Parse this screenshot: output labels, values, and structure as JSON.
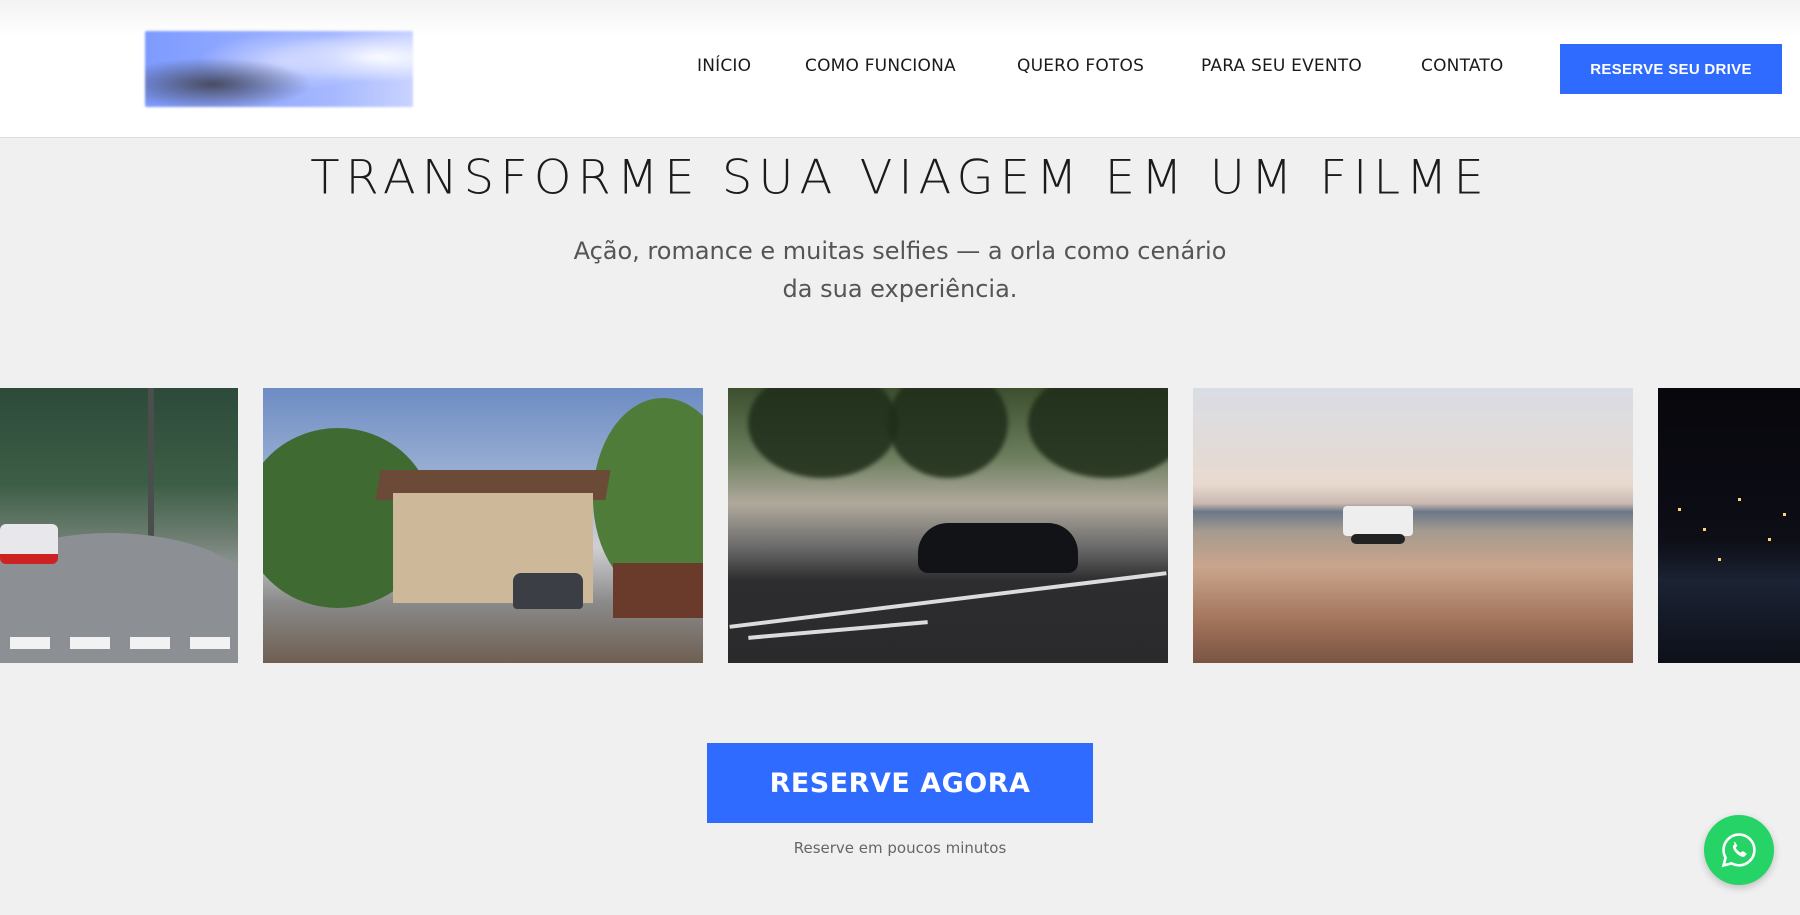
{
  "header": {
    "logo_alt": "Logo",
    "nav": [
      {
        "label": "INÍCIO"
      },
      {
        "label": "COMO FUNCIONA"
      },
      {
        "label": "QUERO FOTOS"
      },
      {
        "label": "PARA SEU EVENTO"
      },
      {
        "label": "CONTATO"
      }
    ],
    "cta_label": "RESERVE SEU DRIVE"
  },
  "hero": {
    "title": "TRANSFORME SUA VIAGEM EM UM FILME",
    "subtitle": "Ação, romance e muitas selfies — a orla como cenário da sua experiência."
  },
  "gallery": {
    "images": [
      {
        "name": "race-car-curve-photo"
      },
      {
        "name": "house-carport-photo"
      },
      {
        "name": "convertible-beach-road-photo"
      },
      {
        "name": "jeep-beach-sunset-photo"
      },
      {
        "name": "city-night-skyline-photo"
      }
    ]
  },
  "booking": {
    "button_label": "RESERVE AGORA",
    "note": "Reserve em poucos minutos"
  },
  "floating": {
    "icon": "whatsapp-icon",
    "color": "#25d366"
  },
  "colors": {
    "accent": "#2f6bff",
    "background": "#f0f0f0"
  }
}
